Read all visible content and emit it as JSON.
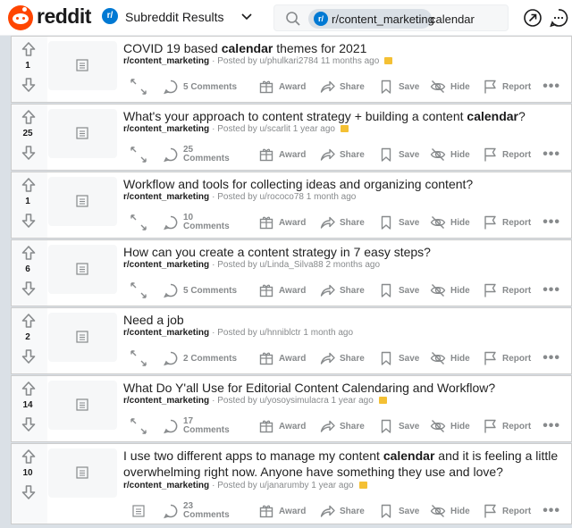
{
  "header": {
    "logo_text": "reddit",
    "community_icon_text": "r/",
    "page_title": "Subreddit Results",
    "search": {
      "chip_icon_text": "r/",
      "chip_label": "r/content_marketing",
      "value": "calendar"
    },
    "icons": [
      "reddit-logo-icon",
      "chevron-down-icon",
      "search-icon",
      "popular-arrow-icon",
      "chat-icon"
    ]
  },
  "action_labels": {
    "award": "Award",
    "share": "Share",
    "save": "Save",
    "hide": "Hide",
    "report": "Report",
    "more": "•••"
  },
  "posts": [
    {
      "score": "1",
      "title_parts": [
        "COVID 19 based ",
        "calendar",
        " themes for 2021"
      ],
      "subreddit": "r/content_marketing",
      "meta": "· Posted by u/phulkari2784 11 months ago",
      "has_award": true,
      "comments": "5 Comments"
    },
    {
      "score": "25",
      "title_parts": [
        "What's your approach to content strategy + building a content ",
        "calendar",
        "?"
      ],
      "subreddit": "r/content_marketing",
      "meta": "· Posted by u/scarlit 1 year ago",
      "has_award": true,
      "comments": "25\nComments"
    },
    {
      "score": "1",
      "title_parts": [
        "Workflow and tools for collecting ideas and organizing content?"
      ],
      "subreddit": "r/content_marketing",
      "meta": "· Posted by u/rococo78 1 month ago",
      "has_award": false,
      "comments": "10\nComments"
    },
    {
      "score": "6",
      "title_parts": [
        "How can you create a content strategy in 7 easy steps?"
      ],
      "subreddit": "r/content_marketing",
      "meta": "· Posted by u/Linda_Silva88 2 months ago",
      "has_award": false,
      "comments": "5 Comments"
    },
    {
      "score": "2",
      "title_parts": [
        "Need a job"
      ],
      "subreddit": "r/content_marketing",
      "meta": "· Posted by u/hnniblctr 1 month ago",
      "has_award": false,
      "comments": "2 Comments"
    },
    {
      "score": "14",
      "title_parts": [
        "What Do Y'all Use for Editorial Content Calendaring and Workflow?"
      ],
      "subreddit": "r/content_marketing",
      "meta": "· Posted by u/yosoysimulacra 1 year ago",
      "has_award": true,
      "comments": "17\nComments"
    },
    {
      "score": "10",
      "title_parts": [
        "I use two different apps to manage my content ",
        "calendar",
        " and it is feeling a little overwhelming right now. Anyone have something they use and love?"
      ],
      "subreddit": "r/content_marketing",
      "meta": "· Posted by u/janarumby 1 year ago",
      "has_award": true,
      "comments": "23\nComments"
    }
  ],
  "colors": {
    "brand": "#ff4500",
    "accent": "#0079d3",
    "muted": "#878a8c",
    "award": "#f4c034",
    "background": "#dae0e6"
  }
}
